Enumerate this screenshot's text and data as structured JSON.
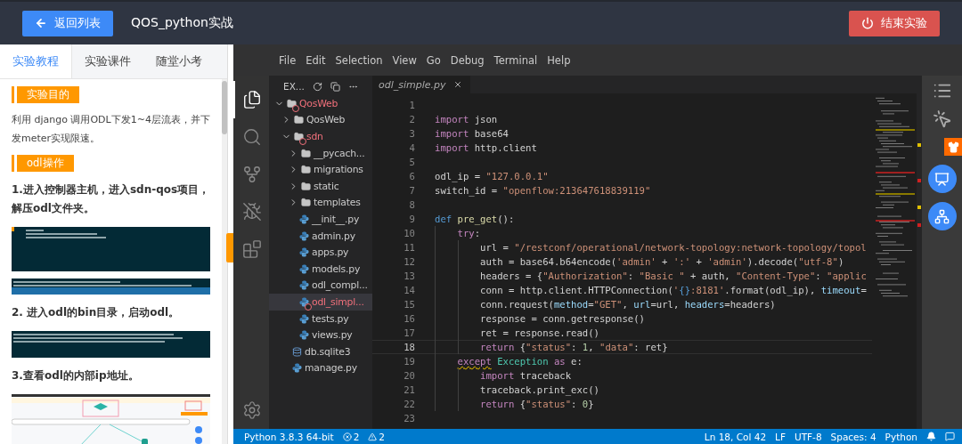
{
  "top_bar": {
    "back_button": "返回列表",
    "title": "QOS_python实战",
    "end_button": "结束实验"
  },
  "left_panel": {
    "tabs": [
      {
        "label": "实验教程",
        "selected": true
      },
      {
        "label": "实验课件",
        "selected": false
      },
      {
        "label": "随堂小考",
        "selected": false
      }
    ],
    "blocks": [
      {
        "kind": "section",
        "text": "实验目的"
      },
      {
        "kind": "paragraph",
        "text": "利用 django 调用ODL下发1~4层流表，并下发meter实现限速。"
      },
      {
        "kind": "section",
        "text": "odl操作"
      },
      {
        "kind": "heading",
        "text": "1.进入控制器主机，进入sdn-qos项目，解压odl文件夹。"
      },
      {
        "kind": "picture"
      },
      {
        "kind": "picture"
      },
      {
        "kind": "heading",
        "text": "2. 进入odl的bin目录，启动odl。"
      },
      {
        "kind": "picture"
      },
      {
        "kind": "heading",
        "text": "3.查看odl的内部ip地址。"
      },
      {
        "kind": "picture"
      }
    ]
  },
  "menu": [
    "File",
    "Edit",
    "Selection",
    "View",
    "Go",
    "Debug",
    "Terminal",
    "Help"
  ],
  "activity_bar": [
    {
      "kind": "explorer",
      "selected": true
    },
    {
      "kind": "search",
      "selected": false
    },
    {
      "kind": "source_control",
      "selected": false
    },
    {
      "kind": "debug",
      "selected": false
    },
    {
      "kind": "extensions",
      "selected": false
    },
    {
      "kind": "settings",
      "selected": false
    }
  ],
  "explorer": {
    "title": "EX...",
    "tree": [
      {
        "label": "QosWeb",
        "kind": "folder",
        "expanded": true,
        "error": true,
        "selected": false,
        "children": [
          {
            "label": "QosWeb",
            "kind": "folder",
            "expanded": false,
            "error": false,
            "selected": false
          },
          {
            "label": "sdn",
            "kind": "folder",
            "expanded": true,
            "error": true,
            "selected": false,
            "children": [
              {
                "label": "__pycach...",
                "kind": "folder",
                "expanded": false,
                "error": false,
                "selected": false
              },
              {
                "label": "migrations",
                "kind": "folder",
                "expanded": false,
                "error": false,
                "selected": false
              },
              {
                "label": "static",
                "kind": "folder",
                "expanded": false,
                "error": false,
                "selected": false
              },
              {
                "label": "templates",
                "kind": "folder",
                "expanded": false,
                "error": false,
                "selected": false
              },
              {
                "label": "__init__.py",
                "kind": "python",
                "error": false,
                "selected": false
              },
              {
                "label": "admin.py",
                "kind": "python",
                "error": false,
                "selected": false
              },
              {
                "label": "apps.py",
                "kind": "python",
                "error": false,
                "selected": false
              },
              {
                "label": "models.py",
                "kind": "python",
                "error": false,
                "selected": false
              },
              {
                "label": "odl_compl...",
                "kind": "python",
                "error": false,
                "selected": false
              },
              {
                "label": "odl_simpl...",
                "kind": "python",
                "error": true,
                "selected": true
              },
              {
                "label": "tests.py",
                "kind": "python",
                "error": false,
                "selected": false
              },
              {
                "label": "views.py",
                "kind": "python",
                "error": false,
                "selected": false
              }
            ]
          },
          {
            "label": "db.sqlite3",
            "kind": "database",
            "error": false,
            "selected": false
          },
          {
            "label": "manage.py",
            "kind": "python",
            "error": false,
            "selected": false
          }
        ]
      }
    ]
  },
  "editor": {
    "tab": "odl_simple.py",
    "lines": [
      {
        "number": "1",
        "current": false
      },
      {
        "number": "2",
        "current": false,
        "tokens": [
          {
            "kind": "keyword",
            "text": "import"
          },
          {
            "kind": "plain",
            "text": " json"
          }
        ]
      },
      {
        "number": "3",
        "current": false,
        "tokens": [
          {
            "kind": "keyword",
            "text": "import"
          },
          {
            "kind": "plain",
            "text": " base64"
          }
        ]
      },
      {
        "number": "4",
        "current": false,
        "tokens": [
          {
            "kind": "keyword",
            "text": "import"
          },
          {
            "kind": "plain",
            "text": " http.client"
          }
        ]
      },
      {
        "number": "5",
        "current": false
      },
      {
        "number": "6",
        "current": false,
        "tokens": [
          {
            "kind": "plain",
            "text": "odl_ip = "
          },
          {
            "kind": "string",
            "text": "\"127.0.0.1\""
          }
        ]
      },
      {
        "number": "7",
        "current": false,
        "tokens": [
          {
            "kind": "plain",
            "text": "switch_id = "
          },
          {
            "kind": "string",
            "text": "\"openflow:213647618839119\""
          }
        ]
      },
      {
        "number": "8",
        "current": false
      },
      {
        "number": "9",
        "current": false,
        "tokens": [
          {
            "kind": "storage",
            "text": "def"
          },
          {
            "kind": "function",
            "text": " pre_get"
          },
          {
            "kind": "plain",
            "text": "():"
          }
        ],
        "children": [
          {
            "number": "10",
            "current": false,
            "tokens": [
              {
                "kind": "keyword",
                "text": "try"
              },
              {
                "kind": "plain",
                "text": ":"
              }
            ],
            "children": [
              {
                "number": "11",
                "current": false,
                "tokens": [
                  {
                    "kind": "plain",
                    "text": "url = "
                  },
                  {
                    "kind": "string",
                    "text": "\"/restconf/operational/network-topology:network-topology/topol"
                  }
                ]
              },
              {
                "number": "12",
                "current": false,
                "tokens": [
                  {
                    "kind": "plain",
                    "text": "auth = base64.b64encode("
                  },
                  {
                    "kind": "string",
                    "text": "'admin'"
                  },
                  {
                    "kind": "plain",
                    "text": " + "
                  },
                  {
                    "kind": "string",
                    "text": "':'"
                  },
                  {
                    "kind": "plain",
                    "text": " + "
                  },
                  {
                    "kind": "string",
                    "text": "'admin'"
                  },
                  {
                    "kind": "plain",
                    "text": ").decode("
                  },
                  {
                    "kind": "string",
                    "text": "\"utf-8\""
                  },
                  {
                    "kind": "plain",
                    "text": ")"
                  }
                ]
              },
              {
                "number": "13",
                "current": false,
                "tokens": [
                  {
                    "kind": "plain",
                    "text": "headers = {"
                  },
                  {
                    "kind": "string",
                    "text": "\"Authorization\""
                  },
                  {
                    "kind": "plain",
                    "text": ": "
                  },
                  {
                    "kind": "string",
                    "text": "\"Basic \""
                  },
                  {
                    "kind": "plain",
                    "text": " + auth, "
                  },
                  {
                    "kind": "string",
                    "text": "\"Content-Type\""
                  },
                  {
                    "kind": "plain",
                    "text": ": "
                  },
                  {
                    "kind": "string",
                    "text": "\"applic"
                  }
                ]
              },
              {
                "number": "14",
                "current": false,
                "tokens": [
                  {
                    "kind": "plain",
                    "text": "conn = http.client.HTTPConnection("
                  },
                  {
                    "kind": "string",
                    "text": "'"
                  },
                  {
                    "kind": "storage",
                    "text": "{}"
                  },
                  {
                    "kind": "string",
                    "text": ":8181'"
                  },
                  {
                    "kind": "plain",
                    "text": ".format(odl_ip), "
                  },
                  {
                    "kind": "parameter",
                    "text": "timeout"
                  },
                  {
                    "kind": "plain",
                    "text": "="
                  }
                ]
              },
              {
                "number": "15",
                "current": false,
                "tokens": [
                  {
                    "kind": "plain",
                    "text": "conn.request("
                  },
                  {
                    "kind": "parameter",
                    "text": "method"
                  },
                  {
                    "kind": "plain",
                    "text": "="
                  },
                  {
                    "kind": "string",
                    "text": "\"GET\""
                  },
                  {
                    "kind": "plain",
                    "text": ", "
                  },
                  {
                    "kind": "parameter",
                    "text": "url"
                  },
                  {
                    "kind": "plain",
                    "text": "=url, "
                  },
                  {
                    "kind": "parameter",
                    "text": "headers"
                  },
                  {
                    "kind": "plain",
                    "text": "=headers)"
                  }
                ]
              },
              {
                "number": "16",
                "current": false,
                "tokens": [
                  {
                    "kind": "plain",
                    "text": "response = conn.getresponse()"
                  }
                ]
              },
              {
                "number": "17",
                "current": false,
                "tokens": [
                  {
                    "kind": "plain",
                    "text": "ret = response.read()"
                  }
                ]
              },
              {
                "number": "18",
                "current": true,
                "tokens": [
                  {
                    "kind": "keyword",
                    "text": "return"
                  },
                  {
                    "kind": "plain",
                    "text": " {"
                  },
                  {
                    "kind": "string",
                    "text": "\"status\""
                  },
                  {
                    "kind": "plain",
                    "text": ": "
                  },
                  {
                    "kind": "number",
                    "text": "1"
                  },
                  {
                    "kind": "plain",
                    "text": ", "
                  },
                  {
                    "kind": "string",
                    "text": "\"data\""
                  },
                  {
                    "kind": "plain",
                    "text": ": ret}"
                  }
                ]
              }
            ]
          },
          {
            "number": "19",
            "current": false,
            "tokens": [
              {
                "kind": "keyword_warning",
                "text": "except"
              },
              {
                "kind": "class",
                "text": " Exception"
              },
              {
                "kind": "keyword",
                "text": " as"
              },
              {
                "kind": "plain",
                "text": " e:"
              }
            ],
            "children": [
              {
                "number": "20",
                "current": false,
                "tokens": [
                  {
                    "kind": "keyword",
                    "text": "import"
                  },
                  {
                    "kind": "plain",
                    "text": " traceback"
                  }
                ]
              },
              {
                "number": "21",
                "current": false,
                "tokens": [
                  {
                    "kind": "plain",
                    "text": "traceback.print_exc()"
                  }
                ]
              },
              {
                "number": "22",
                "current": false,
                "tokens": [
                  {
                    "kind": "keyword",
                    "text": "return"
                  },
                  {
                    "kind": "plain",
                    "text": " {"
                  },
                  {
                    "kind": "string",
                    "text": "\"status\""
                  },
                  {
                    "kind": "plain",
                    "text": ": "
                  },
                  {
                    "kind": "number",
                    "text": "0"
                  },
                  {
                    "kind": "plain",
                    "text": "}"
                  }
                ]
              }
            ]
          }
        ]
      },
      {
        "number": "23",
        "current": false
      }
    ]
  },
  "side_tools": [
    {
      "kind": "list"
    },
    {
      "kind": "pointer"
    },
    {
      "kind": "shirt"
    },
    {
      "kind": "chart"
    },
    {
      "kind": "hierarchy"
    }
  ],
  "status_bar": {
    "left": [
      {
        "kind": "text",
        "text": "Python 3.8.3 64-bit"
      },
      {
        "kind": "errors",
        "text": "2"
      },
      {
        "kind": "warnings",
        "text": "2"
      }
    ],
    "right": [
      {
        "kind": "text",
        "text": "Ln 18, Col 42"
      },
      {
        "kind": "text",
        "text": "LF"
      },
      {
        "kind": "text",
        "text": "UTF-8"
      },
      {
        "kind": "text",
        "text": "Spaces: 4"
      },
      {
        "kind": "text",
        "text": "Python"
      },
      {
        "kind": "bell"
      },
      {
        "kind": "feedback"
      }
    ]
  }
}
